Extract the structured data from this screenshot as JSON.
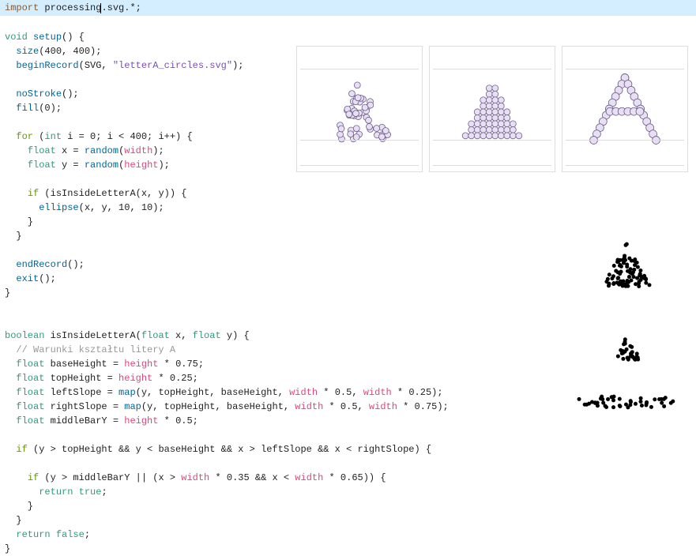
{
  "editor": {
    "highlighted_line_index": 0,
    "lines": [
      {
        "tokens": [
          {
            "t": "import ",
            "c": "kw-import"
          },
          {
            "t": "processing",
            "c": "plain"
          },
          {
            "t": ".svg.*;",
            "c": "plain"
          }
        ],
        "caret_after_token": 1
      },
      {
        "tokens": []
      },
      {
        "tokens": [
          {
            "t": "void ",
            "c": "kw-type"
          },
          {
            "t": "setup",
            "c": "kw-func"
          },
          {
            "t": "() {",
            "c": "plain"
          }
        ]
      },
      {
        "tokens": [
          {
            "t": "  ",
            "c": "plain"
          },
          {
            "t": "size",
            "c": "kw-func"
          },
          {
            "t": "(400, 400);",
            "c": "plain"
          }
        ]
      },
      {
        "tokens": [
          {
            "t": "  ",
            "c": "plain"
          },
          {
            "t": "beginRecord",
            "c": "kw-func"
          },
          {
            "t": "(SVG, ",
            "c": "plain"
          },
          {
            "t": "\"letterA_circles.svg\"",
            "c": "str"
          },
          {
            "t": ");",
            "c": "plain"
          }
        ]
      },
      {
        "tokens": []
      },
      {
        "tokens": [
          {
            "t": "  ",
            "c": "plain"
          },
          {
            "t": "noStroke",
            "c": "kw-func"
          },
          {
            "t": "();",
            "c": "plain"
          }
        ]
      },
      {
        "tokens": [
          {
            "t": "  ",
            "c": "plain"
          },
          {
            "t": "fill",
            "c": "kw-func"
          },
          {
            "t": "(0);",
            "c": "plain"
          }
        ]
      },
      {
        "tokens": []
      },
      {
        "tokens": [
          {
            "t": "  ",
            "c": "plain"
          },
          {
            "t": "for ",
            "c": "kw-for"
          },
          {
            "t": "(",
            "c": "plain"
          },
          {
            "t": "int ",
            "c": "kw-type"
          },
          {
            "t": "i = 0; i < 400; i++) {",
            "c": "plain"
          }
        ]
      },
      {
        "tokens": [
          {
            "t": "    ",
            "c": "plain"
          },
          {
            "t": "float ",
            "c": "kw-type"
          },
          {
            "t": "x = ",
            "c": "plain"
          },
          {
            "t": "random",
            "c": "kw-func"
          },
          {
            "t": "(",
            "c": "plain"
          },
          {
            "t": "width",
            "c": "kw-const"
          },
          {
            "t": ");",
            "c": "plain"
          }
        ]
      },
      {
        "tokens": [
          {
            "t": "    ",
            "c": "plain"
          },
          {
            "t": "float ",
            "c": "kw-type"
          },
          {
            "t": "y = ",
            "c": "plain"
          },
          {
            "t": "random",
            "c": "kw-func"
          },
          {
            "t": "(",
            "c": "plain"
          },
          {
            "t": "height",
            "c": "kw-const"
          },
          {
            "t": ");",
            "c": "plain"
          }
        ]
      },
      {
        "tokens": []
      },
      {
        "tokens": [
          {
            "t": "    ",
            "c": "plain"
          },
          {
            "t": "if ",
            "c": "kw-if"
          },
          {
            "t": "(isInsideLetterA(x, y)) {",
            "c": "plain"
          }
        ]
      },
      {
        "tokens": [
          {
            "t": "      ",
            "c": "plain"
          },
          {
            "t": "ellipse",
            "c": "kw-func"
          },
          {
            "t": "(x, y, 10, 10);",
            "c": "plain"
          }
        ]
      },
      {
        "tokens": [
          {
            "t": "    }",
            "c": "plain"
          }
        ]
      },
      {
        "tokens": [
          {
            "t": "  }",
            "c": "plain"
          }
        ]
      },
      {
        "tokens": []
      },
      {
        "tokens": [
          {
            "t": "  ",
            "c": "plain"
          },
          {
            "t": "endRecord",
            "c": "kw-func"
          },
          {
            "t": "();",
            "c": "plain"
          }
        ]
      },
      {
        "tokens": [
          {
            "t": "  ",
            "c": "plain"
          },
          {
            "t": "exit",
            "c": "kw-func"
          },
          {
            "t": "();",
            "c": "plain"
          }
        ]
      },
      {
        "tokens": [
          {
            "t": "}",
            "c": "plain"
          }
        ]
      },
      {
        "tokens": []
      },
      {
        "tokens": []
      },
      {
        "tokens": [
          {
            "t": "boolean ",
            "c": "kw-bool"
          },
          {
            "t": "isInsideLetterA(",
            "c": "plain"
          },
          {
            "t": "float ",
            "c": "kw-type"
          },
          {
            "t": "x, ",
            "c": "plain"
          },
          {
            "t": "float ",
            "c": "kw-type"
          },
          {
            "t": "y) {",
            "c": "plain"
          }
        ]
      },
      {
        "tokens": [
          {
            "t": "  ",
            "c": "plain"
          },
          {
            "t": "// Warunki kształtu litery A",
            "c": "comment"
          }
        ]
      },
      {
        "tokens": [
          {
            "t": "  ",
            "c": "plain"
          },
          {
            "t": "float ",
            "c": "kw-type"
          },
          {
            "t": "baseHeight = ",
            "c": "plain"
          },
          {
            "t": "height",
            "c": "kw-const"
          },
          {
            "t": " * 0.75;",
            "c": "plain"
          }
        ]
      },
      {
        "tokens": [
          {
            "t": "  ",
            "c": "plain"
          },
          {
            "t": "float ",
            "c": "kw-type"
          },
          {
            "t": "topHeight = ",
            "c": "plain"
          },
          {
            "t": "height",
            "c": "kw-const"
          },
          {
            "t": " * 0.25;",
            "c": "plain"
          }
        ]
      },
      {
        "tokens": [
          {
            "t": "  ",
            "c": "plain"
          },
          {
            "t": "float ",
            "c": "kw-type"
          },
          {
            "t": "leftSlope = ",
            "c": "plain"
          },
          {
            "t": "map",
            "c": "kw-func"
          },
          {
            "t": "(y, topHeight, baseHeight, ",
            "c": "plain"
          },
          {
            "t": "width",
            "c": "kw-const"
          },
          {
            "t": " * 0.5, ",
            "c": "plain"
          },
          {
            "t": "width",
            "c": "kw-const"
          },
          {
            "t": " * 0.25);",
            "c": "plain"
          }
        ]
      },
      {
        "tokens": [
          {
            "t": "  ",
            "c": "plain"
          },
          {
            "t": "float ",
            "c": "kw-type"
          },
          {
            "t": "rightSlope = ",
            "c": "plain"
          },
          {
            "t": "map",
            "c": "kw-func"
          },
          {
            "t": "(y, topHeight, baseHeight, ",
            "c": "plain"
          },
          {
            "t": "width",
            "c": "kw-const"
          },
          {
            "t": " * 0.5, ",
            "c": "plain"
          },
          {
            "t": "width",
            "c": "kw-const"
          },
          {
            "t": " * 0.75);",
            "c": "plain"
          }
        ]
      },
      {
        "tokens": [
          {
            "t": "  ",
            "c": "plain"
          },
          {
            "t": "float ",
            "c": "kw-type"
          },
          {
            "t": "middleBarY = ",
            "c": "plain"
          },
          {
            "t": "height",
            "c": "kw-const"
          },
          {
            "t": " * 0.5;",
            "c": "plain"
          }
        ]
      },
      {
        "tokens": []
      },
      {
        "tokens": [
          {
            "t": "  ",
            "c": "plain"
          },
          {
            "t": "if ",
            "c": "kw-if"
          },
          {
            "t": "(y > topHeight && y < baseHeight && x > leftSlope && x < rightSlope) {",
            "c": "plain"
          }
        ]
      },
      {
        "tokens": []
      },
      {
        "tokens": [
          {
            "t": "    ",
            "c": "plain"
          },
          {
            "t": "if ",
            "c": "kw-if"
          },
          {
            "t": "(y > middleBarY || (x > ",
            "c": "plain"
          },
          {
            "t": "width",
            "c": "kw-const"
          },
          {
            "t": " * 0.35 && x < ",
            "c": "plain"
          },
          {
            "t": "width",
            "c": "kw-const"
          },
          {
            "t": " * 0.65)) {",
            "c": "plain"
          }
        ]
      },
      {
        "tokens": [
          {
            "t": "      ",
            "c": "plain"
          },
          {
            "t": "return ",
            "c": "kw-return"
          },
          {
            "t": "true",
            "c": "kw-type"
          },
          {
            "t": ";",
            "c": "plain"
          }
        ]
      },
      {
        "tokens": [
          {
            "t": "    }",
            "c": "plain"
          }
        ]
      },
      {
        "tokens": [
          {
            "t": "  }",
            "c": "plain"
          }
        ]
      },
      {
        "tokens": [
          {
            "t": "  ",
            "c": "plain"
          },
          {
            "t": "return ",
            "c": "kw-return"
          },
          {
            "t": "false",
            "c": "kw-type"
          },
          {
            "t": ";",
            "c": "plain"
          }
        ]
      },
      {
        "tokens": [
          {
            "t": "}",
            "c": "plain"
          }
        ]
      }
    ]
  },
  "thumbnails": [
    {
      "name": "random-circles-a",
      "style": "random",
      "circle_r": 4
    },
    {
      "name": "grid-circles-a",
      "style": "grid",
      "circle_r": 4
    },
    {
      "name": "outline-circles-a",
      "style": "outline",
      "circle_r": 5
    }
  ],
  "outputs": [
    {
      "name": "output-dense-a",
      "dot_count": 150,
      "dot_r": 2.5,
      "shape": "A"
    },
    {
      "name": "output-sparse-a",
      "dot_count": 30,
      "dot_r": 2.5,
      "shape": "small-tri"
    },
    {
      "name": "output-bar",
      "dot_count": 45,
      "dot_r": 2.5,
      "shape": "bar"
    }
  ],
  "colors": {
    "circle_fill": "#e8e0f2",
    "circle_stroke": "#6b5b8a",
    "dot_fill": "#000000",
    "guide_rule": "#f0d9b5",
    "highlight_bg": "#d4edff"
  }
}
